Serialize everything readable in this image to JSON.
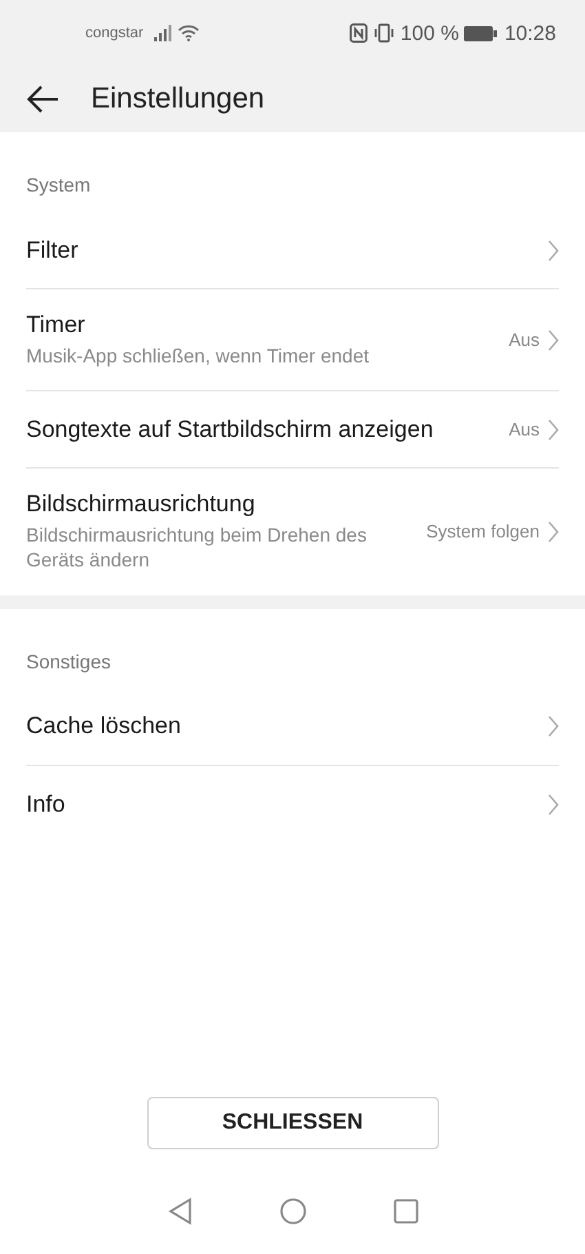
{
  "status_bar": {
    "carrier": "congstar",
    "battery": "100 %",
    "time": "10:28"
  },
  "header": {
    "title": "Einstellungen"
  },
  "sections": [
    {
      "title": "System",
      "items": [
        {
          "title": "Filter"
        },
        {
          "title": "Timer",
          "subtitle": "Musik-App schließen, wenn Timer endet",
          "value": "Aus"
        },
        {
          "title": "Songtexte auf Startbildschirm anzeigen",
          "value": "Aus"
        },
        {
          "title": "Bildschirmausrichtung",
          "subtitle": "Bildschirmausrichtung beim Drehen des Geräts ändern",
          "value": "System folgen"
        }
      ]
    },
    {
      "title": "Sonstiges",
      "items": [
        {
          "title": "Cache löschen"
        },
        {
          "title": "Info"
        }
      ]
    }
  ],
  "close_button": "SCHLIESSEN"
}
